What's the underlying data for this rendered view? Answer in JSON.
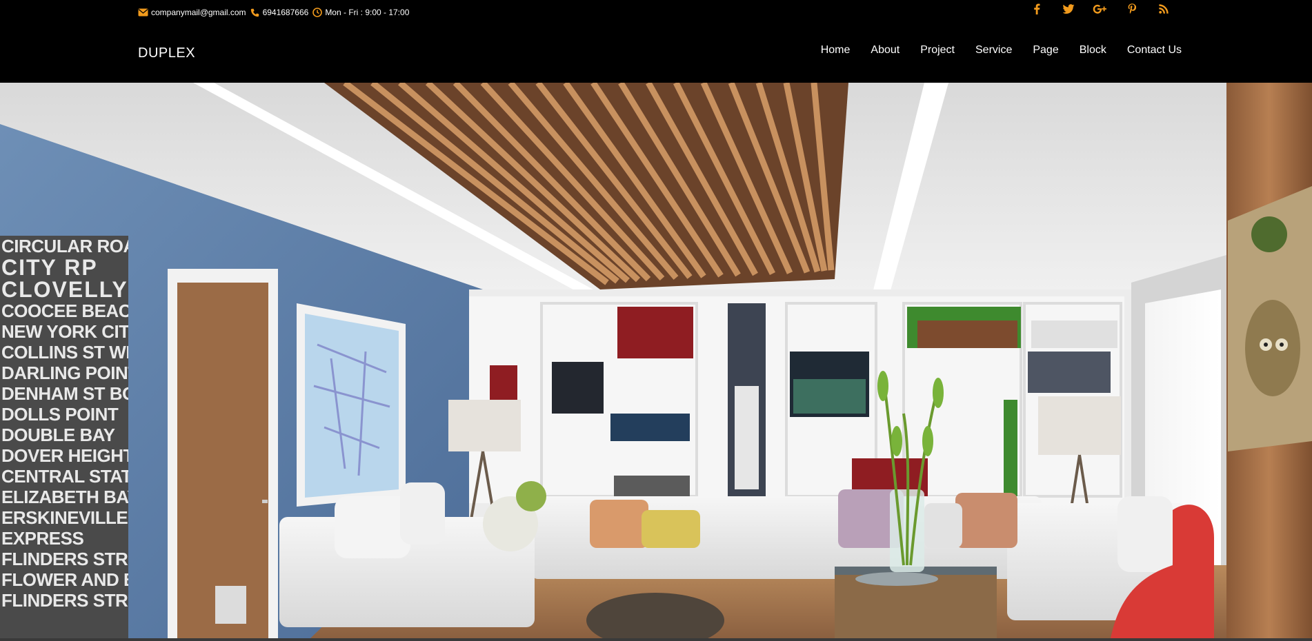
{
  "contact": {
    "email": "companymail@gmail.com",
    "phone": "6941687666",
    "hours": "Mon - Fri : 9:00 - 17:00",
    "icon_color": "#f29b1d",
    "email_icon": "envelope-icon",
    "phone_icon": "phone-icon",
    "hours_icon": "clock-icon"
  },
  "social": [
    {
      "name": "facebook-icon",
      "glyph": "f"
    },
    {
      "name": "twitter-icon",
      "glyph": "t"
    },
    {
      "name": "google-plus-icon",
      "glyph": "G+"
    },
    {
      "name": "pinterest-icon",
      "glyph": "p"
    },
    {
      "name": "rss-icon",
      "glyph": "rss"
    }
  ],
  "brand": "DUPLEX",
  "nav": [
    "Home",
    "About",
    "Project",
    "Service",
    "Page",
    "Block",
    "Contact Us"
  ],
  "hero": {
    "poster_lines": [
      "CIRCULAR ROAD",
      "CITY RP",
      "CLOVELLY",
      "COOCEE BEACH",
      "NEW YORK CITY",
      "COLLINS ST WEST",
      "DARLING POINT",
      "DENHAM ST BOUND",
      "DOLLS POINT",
      "DOUBLE BAY",
      "DOVER HEIGHTS",
      "CENTRAL STATION",
      "ELIZABETH BAY",
      "ERSKINEVILLE",
      "EXPRESS",
      "FLINDERS STREET",
      "FLOWER AND BUN ST",
      "FLINDERS STREET"
    ]
  }
}
